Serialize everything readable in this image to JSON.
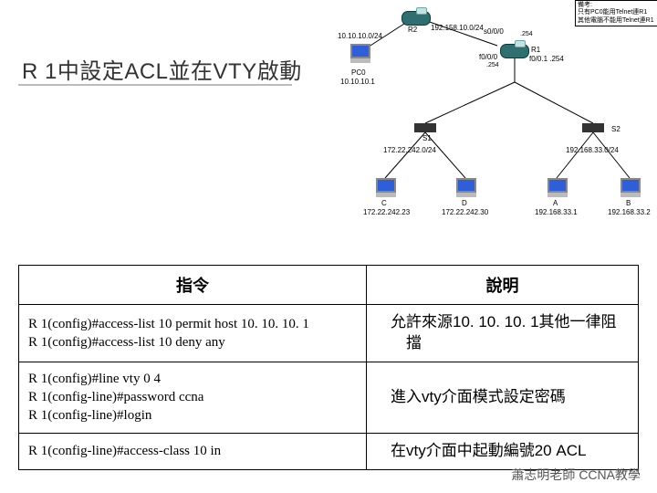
{
  "title": "R 1中設定ACL並在VTY啟動",
  "topology": {
    "note_line1": "只有PC0能用Telnet連R1",
    "note_line2": "其他電腦不能用Telnet連R1",
    "subnets": {
      "pc0_net": "10.10.10.0/24",
      "r1r2_net": "192.158.10.0/24",
      "left_net": "172.22.242.0/24",
      "right_net": "192.168.33.0/24"
    },
    "pc0": "PC0",
    "pc0_ip": "10.10.10.1",
    "r2": "R2",
    "r1": "R1",
    "iface_s000": "s0/0/0",
    "iface_f000": "f0/0/0",
    "addr_254a": ".254",
    "addr_254b": ".254",
    "r1_lan_gw": "f0/0.1 .254",
    "s1": "S1",
    "s2": "S2",
    "host_c": "C",
    "ip_c": "172.22.242.23",
    "host_d": "D",
    "ip_d": "172.22.242.30",
    "host_a": "A",
    "ip_a": "192.168.33.1",
    "host_b": "B",
    "ip_b": "192.168.33.2"
  },
  "table": {
    "head_cmd": "指令",
    "head_desc": "說明",
    "rows": [
      {
        "cmd": "R 1(config)#access-list 10 permit host 10. 10. 10. 1\nR 1(config)#access-list 10 deny any",
        "desc": "允許來源10. 10. 10. 1其他一律阻\n　擋"
      },
      {
        "cmd": "R 1(config)#line vty 0 4\nR 1(config-line)#password ccna\nR 1(config-line)#login",
        "desc": "進入vty介面模式設定密碼"
      },
      {
        "cmd": "R 1(config-line)#access-class 10 in",
        "desc": "在vty介面中起動編號20 ACL"
      }
    ]
  },
  "footer": "蕭志明老師 CCNA教學"
}
